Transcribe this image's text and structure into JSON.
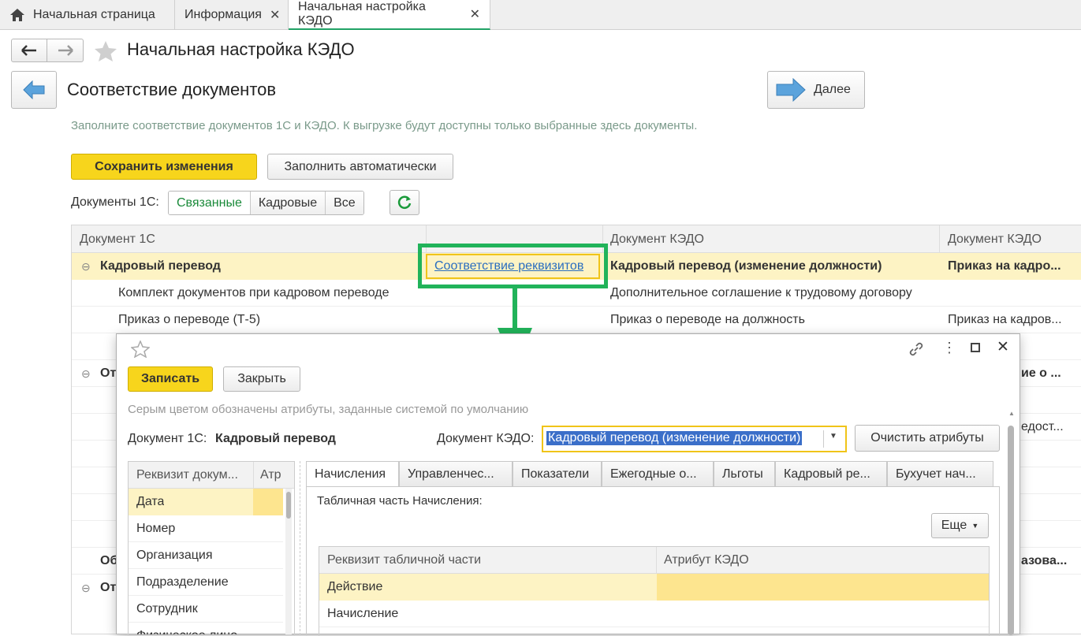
{
  "tabs": [
    {
      "label": "Начальная страница"
    },
    {
      "label": "Информация"
    },
    {
      "label": "Начальная настройка КЭДО"
    }
  ],
  "window_title": "Начальная настройка КЭДО",
  "page": {
    "title": "Соответствие документов",
    "next_label": "Далее",
    "hint": "Заполните соответствие документов 1С и КЭДО. К выгрузке будут доступны только выбранные здесь документы.",
    "save_label": "Сохранить изменения",
    "autofill_label": "Заполнить автоматически",
    "filter_label": "Документы 1С:",
    "filters": [
      "Связанные",
      "Кадровые",
      "Все"
    ]
  },
  "table": {
    "headers": [
      "Документ 1С",
      "",
      "Документ КЭДО",
      "Документ КЭДО"
    ],
    "group_row": {
      "doc1c": "Кадровый перевод",
      "link": "Соответствие реквизитов",
      "kedo1": "Кадровый перевод (изменение должности)",
      "kedo2": "Приказ на кадро..."
    },
    "rows": [
      {
        "doc1c": "Комплект документов при кадровом переводе",
        "kedo1": "Дополнительное соглашение к трудовому договору",
        "kedo2": ""
      },
      {
        "doc1c": "Приказ о переводе (Т-5)",
        "kedo1": "Приказ о переводе на должность",
        "kedo2": "Приказ на кадров..."
      }
    ],
    "partial": {
      "left1": "От",
      "right1": "ие о ...",
      "right2": "едост...",
      "left2": "Об",
      "right3": "азова...",
      "left3": "От"
    }
  },
  "dialog": {
    "write_label": "Записать",
    "close_label": "Закрыть",
    "hint": "Серым цветом обозначены атрибуты, заданные системой по умолчанию",
    "doc1c_label": "Документ 1С:",
    "doc1c_value": "Кадровый перевод",
    "kedo_label": "Документ КЭДО:",
    "kedo_value": "Кадровый перевод (изменение должности)",
    "clear_label": "Очистить атрибуты",
    "left_headers": [
      "Реквизит докум...",
      "Атр"
    ],
    "left_rows": [
      "Дата",
      "Номер",
      "Организация",
      "Подразделение",
      "Сотрудник",
      "Физическое лицо"
    ],
    "inner_tabs": [
      "Начисления",
      "Управленчес...",
      "Показатели",
      "Ежегодные о...",
      "Льготы",
      "Кадровый ре...",
      "Бухучет нач..."
    ],
    "tab_caption": "Табличная часть Начисления:",
    "more_label": "Еще",
    "right_headers": [
      "Реквизит табличной части",
      "Атрибут КЭДО"
    ],
    "right_rows": [
      "Действие",
      "Начисление"
    ]
  },
  "colors": {
    "accent_green": "#21b35a",
    "highlight_yellow": "#fdf3c4",
    "button_yellow": "#f7d51c"
  }
}
